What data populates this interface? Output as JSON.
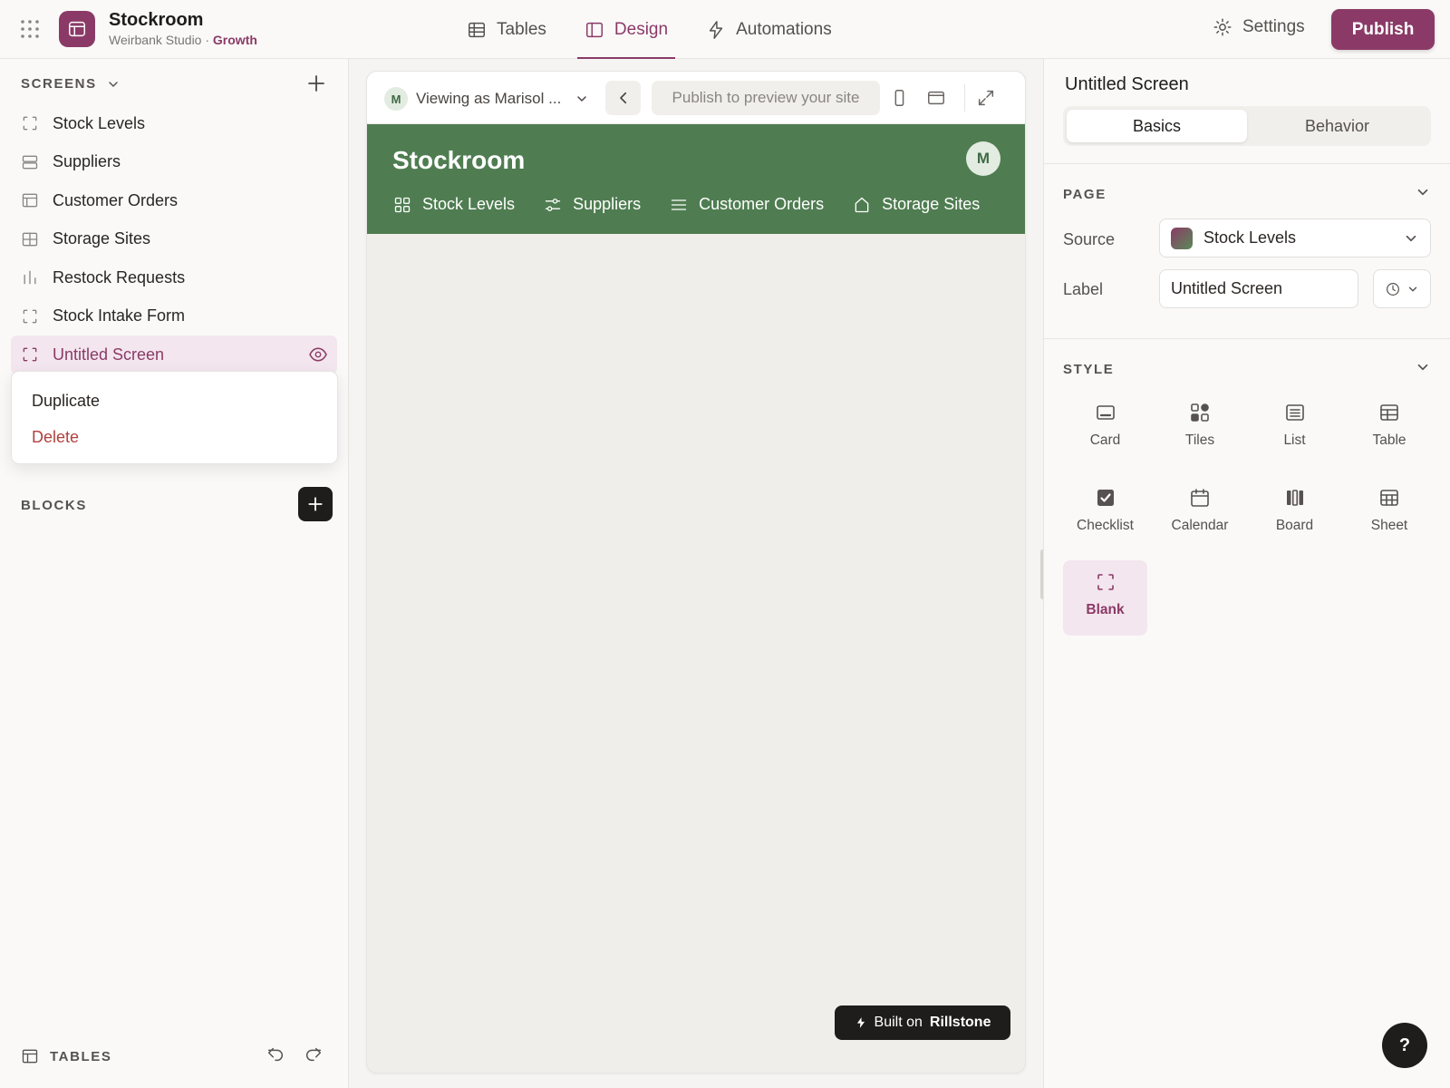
{
  "app": {
    "name": "Stockroom",
    "workspace": "Weirbank Studio",
    "separator": " · ",
    "plan": "Growth",
    "brand_color": "#8b3a67"
  },
  "topnav": {
    "tabs": [
      {
        "label": "Tables",
        "icon": "table-icon"
      },
      {
        "label": "Design",
        "icon": "layout-icon",
        "active": true
      },
      {
        "label": "Automations",
        "icon": "lightning-icon"
      }
    ],
    "settings_label": "Settings",
    "publish_label": "Publish"
  },
  "left": {
    "screens_heading": "SCREENS",
    "screens": [
      {
        "label": "Stock Levels",
        "icon": "blank-screen-icon"
      },
      {
        "label": "Suppliers",
        "icon": "rows-icon"
      },
      {
        "label": "Customer Orders",
        "icon": "table-icon"
      },
      {
        "label": "Storage Sites",
        "icon": "grid-icon"
      },
      {
        "label": "Restock Requests",
        "icon": "bar-chart-icon"
      },
      {
        "label": "Stock Intake Form",
        "icon": "blank-screen-icon"
      },
      {
        "label": "Untitled Screen",
        "icon": "blank-screen-icon",
        "active": true
      }
    ],
    "context_menu": [
      "Duplicate",
      "Delete"
    ],
    "blocks_heading": "BLOCKS",
    "tables_heading": "TABLES"
  },
  "preview": {
    "viewing_as": "Viewing as Marisol ...",
    "viewer_initial": "M",
    "url_placeholder": "Publish to preview your site",
    "site_title": "Stockroom",
    "site_avatar": "M",
    "site_nav": [
      {
        "label": "Stock Levels",
        "icon": "tiles-icon"
      },
      {
        "label": "Suppliers",
        "icon": "sliders-icon"
      },
      {
        "label": "Customer Orders",
        "icon": "menu-lines-icon"
      },
      {
        "label": "Storage Sites",
        "icon": "home-icon"
      }
    ],
    "header_color": "#4f7d51",
    "built_on_prefix": "Built on",
    "built_on_brand": "Rillstone"
  },
  "right": {
    "title": "Untitled Screen",
    "tabs": [
      "Basics",
      "Behavior"
    ],
    "active_tab": "Basics",
    "page_heading": "PAGE",
    "source_label": "Source",
    "source_value": "Stock Levels",
    "label_label": "Label",
    "label_value": "Untitled Screen",
    "style_heading": "STYLE",
    "styles": [
      {
        "label": "Card",
        "icon": "card-icon"
      },
      {
        "label": "Tiles",
        "icon": "tiles-icon"
      },
      {
        "label": "List",
        "icon": "list-icon"
      },
      {
        "label": "Table",
        "icon": "table-icon"
      },
      {
        "label": "Checklist",
        "icon": "checkbox-icon"
      },
      {
        "label": "Calendar",
        "icon": "calendar-icon"
      },
      {
        "label": "Board",
        "icon": "board-icon"
      },
      {
        "label": "Sheet",
        "icon": "sheet-icon"
      },
      {
        "label": "Blank",
        "icon": "blank-screen-icon",
        "active": true
      }
    ]
  },
  "help_label": "?"
}
